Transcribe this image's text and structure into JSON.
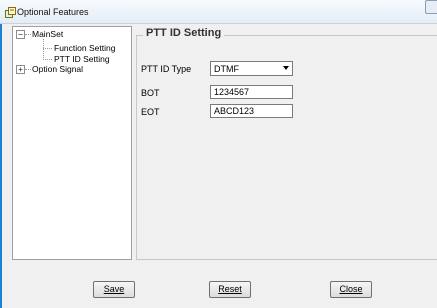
{
  "window": {
    "title": "Optional Features"
  },
  "tree": {
    "root": {
      "label": "MainSet",
      "expander": "−"
    },
    "children": [
      "Function Setting",
      "PTT ID Setting"
    ],
    "second": {
      "label": "Option Signal",
      "expander": "+"
    }
  },
  "group": {
    "title": "PTT ID Setting"
  },
  "fields": {
    "ptt_id_type": {
      "label": "PTT ID Type",
      "value": "DTMF"
    },
    "bot": {
      "label": "BOT",
      "value": "1234567"
    },
    "eot": {
      "label": "EOT",
      "value": "ABCD123"
    }
  },
  "buttons": {
    "save": "Save",
    "reset": "Reset",
    "close": "Close"
  },
  "icons": {
    "app": "app-window-icon",
    "dropdown": "chevron-down-icon"
  },
  "colors": {
    "accent_edge": "#1e7fd6"
  }
}
